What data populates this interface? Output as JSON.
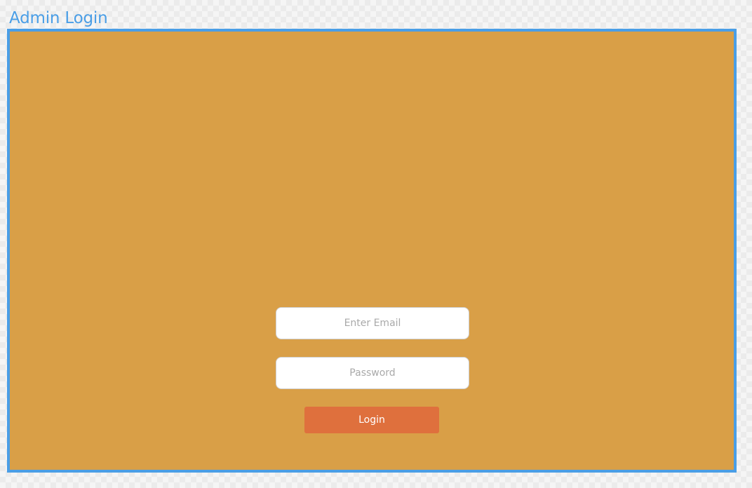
{
  "frame": {
    "title": "Admin Login"
  },
  "login_form": {
    "email_placeholder": "Enter Email",
    "email_value": "",
    "password_placeholder": "Password",
    "password_value": "",
    "login_label": "Login"
  },
  "colors": {
    "frame_border": "#4a9ee6",
    "background": "#d99f47",
    "login_button": "#df703d",
    "field_background": "#ffffff"
  }
}
